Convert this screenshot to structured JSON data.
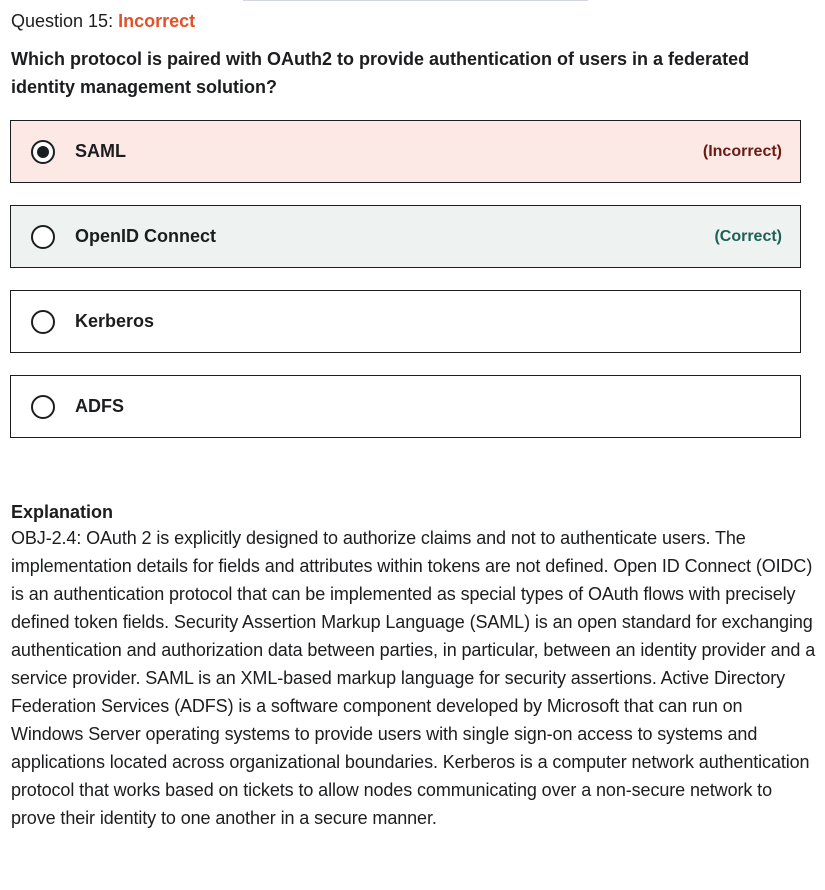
{
  "question": {
    "number_label": "Question 15:",
    "status": "Incorrect",
    "status_color": "#e1522a",
    "text": "Which protocol is paired with OAuth2 to provide authentication of users in a federated identity management solution?"
  },
  "options": [
    {
      "label": "SAML",
      "selected": true,
      "verdict": "(Incorrect)",
      "state": "incorrect"
    },
    {
      "label": "OpenID Connect",
      "selected": false,
      "verdict": "(Correct)",
      "state": "correct"
    },
    {
      "label": "Kerberos",
      "selected": false,
      "verdict": "",
      "state": "neutral"
    },
    {
      "label": "ADFS",
      "selected": false,
      "verdict": "",
      "state": "neutral"
    }
  ],
  "explanation": {
    "title": "Explanation",
    "body": "OBJ-2.4: OAuth 2 is explicitly designed to authorize claims and not to authenticate users. The implementation details for fields and attributes within tokens are not defined. Open ID Connect (OIDC) is an authentication protocol that can be implemented as special types of OAuth flows with precisely defined token fields. Security Assertion Markup Language (SAML) is an open standard for exchanging authentication and authorization data between parties, in particular, between an identity provider and a service provider. SAML is an XML-based markup language for security assertions. Active Directory Federation Services (ADFS) is a software component developed by Microsoft that can run on Windows Server operating systems to provide users with single sign-on access to systems and applications located across organizational boundaries. Kerberos is a computer network authentication protocol that works based on tickets to allow nodes communicating over a non-secure network to prove their identity to one another in a secure manner."
  },
  "colors": {
    "incorrect_bg": "#fce9e6",
    "correct_bg": "#eef3f1",
    "incorrect_text": "#6b1c12",
    "correct_text": "#1e6055"
  }
}
